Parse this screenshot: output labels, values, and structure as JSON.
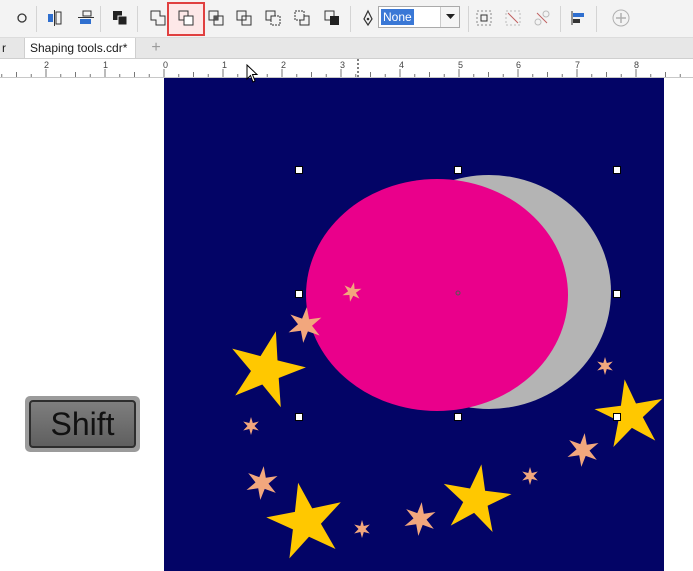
{
  "toolbar": {
    "buttons": [
      "outline-circle-icon",
      "align-icon",
      "align-distribute-icon",
      "order-icon",
      "weld-icon",
      "trim-icon",
      "intersect-icon",
      "simplify-icon",
      "front-minus-back-icon",
      "back-minus-front-icon",
      "create-boundary-icon",
      "outline-pen-icon",
      "group-icon",
      "ungroup-icon",
      "ungroup-all-icon",
      "align-and-distribute-icon",
      "add-icon"
    ],
    "outline_width": "None",
    "highlight_color": "#e04040"
  },
  "tabs": {
    "partial_tab": "r",
    "active_tab": "Shaping tools.cdr*",
    "add_tab": "+"
  },
  "ruler": {
    "labels": [
      "2",
      "1",
      "0",
      "1",
      "2",
      "3",
      "4",
      "5",
      "6",
      "7",
      "8"
    ]
  },
  "shift_key": {
    "label": "Shift"
  },
  "canvas": {
    "background_color": "#030466",
    "pink_circle_color": "#ea008b",
    "moon_color": "#b4b4b4",
    "gold_star_color": "#ffc800",
    "peach_star_color": "#f2a77d"
  }
}
